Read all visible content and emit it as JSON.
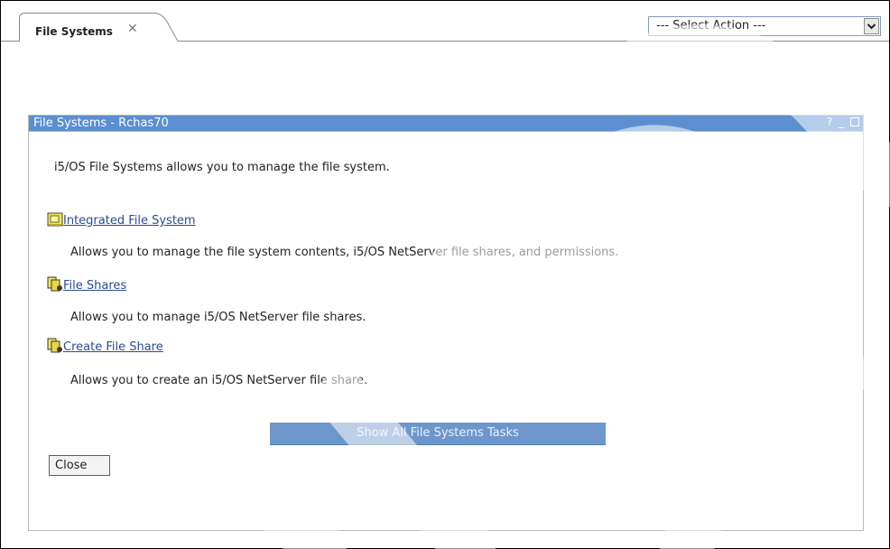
{
  "tab": {
    "label": "File Systems",
    "close_glyph": "✕"
  },
  "action_select": {
    "value": "--- Select Action ---"
  },
  "portlet": {
    "title": "File Systems - Rchas70",
    "help_glyph": "?",
    "minimize_glyph": "_",
    "intro": "i5/OS File Systems allows you to manage the file system.",
    "tasks": [
      {
        "label": "Integrated File System",
        "description": "Allows you to manage the file system contents, i5/OS NetServer file shares, and permissions.",
        "icon": "folder-icon"
      },
      {
        "label": "File Shares",
        "description": "Allows you to manage i5/OS NetServer file shares.",
        "icon": "file-share-icon"
      },
      {
        "label": "Create File Share",
        "description": "Allows you to create an i5/OS NetServer file share.",
        "icon": "file-share-icon"
      }
    ],
    "show_all_label": "Show All File Systems Tasks",
    "close_label": "Close"
  },
  "colors": {
    "title_bar": "#5b8fd0",
    "link": "#2a4c8f",
    "show_all_button": "#6d97cc"
  }
}
